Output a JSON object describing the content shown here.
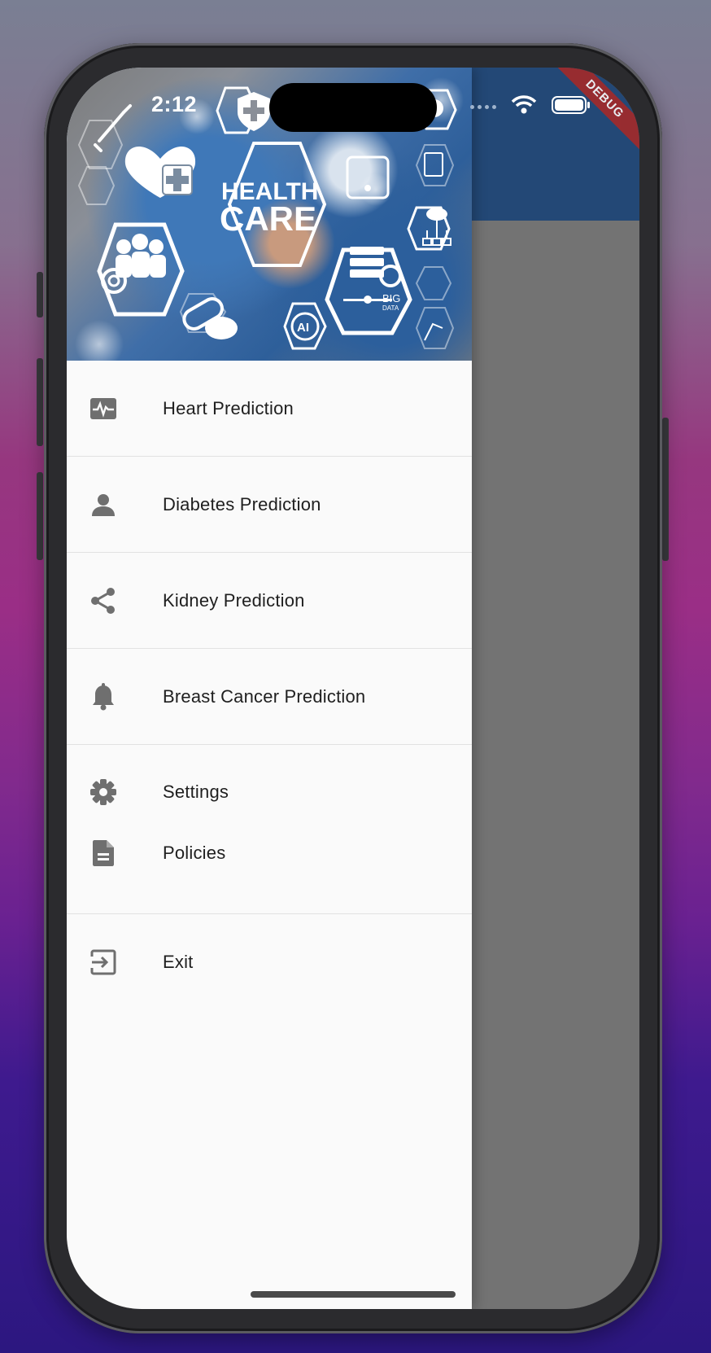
{
  "status_bar": {
    "time": "2:12"
  },
  "debug_banner": "DEBUG",
  "header_image": {
    "line1": "HEALTH",
    "line2": "CARE",
    "badge_big": "BIG",
    "badge_data": "DATA",
    "badge_ai": "AI"
  },
  "drawer": {
    "items": [
      {
        "label": "Heart Prediction",
        "icon": "monitor-heart-icon"
      },
      {
        "label": "Diabetes Prediction",
        "icon": "person-icon"
      },
      {
        "label": "Kidney Prediction",
        "icon": "share-icon"
      },
      {
        "label": "Breast Cancer Prediction",
        "icon": "bell-icon"
      },
      {
        "label": "Settings",
        "icon": "gear-icon"
      },
      {
        "label": "Policies",
        "icon": "document-icon"
      },
      {
        "label": "Exit",
        "icon": "exit-icon"
      }
    ]
  },
  "colors": {
    "appbar": "#234876",
    "scrim": "#737373",
    "drawer_bg": "#fafafa",
    "icon": "#6f6f6f"
  }
}
